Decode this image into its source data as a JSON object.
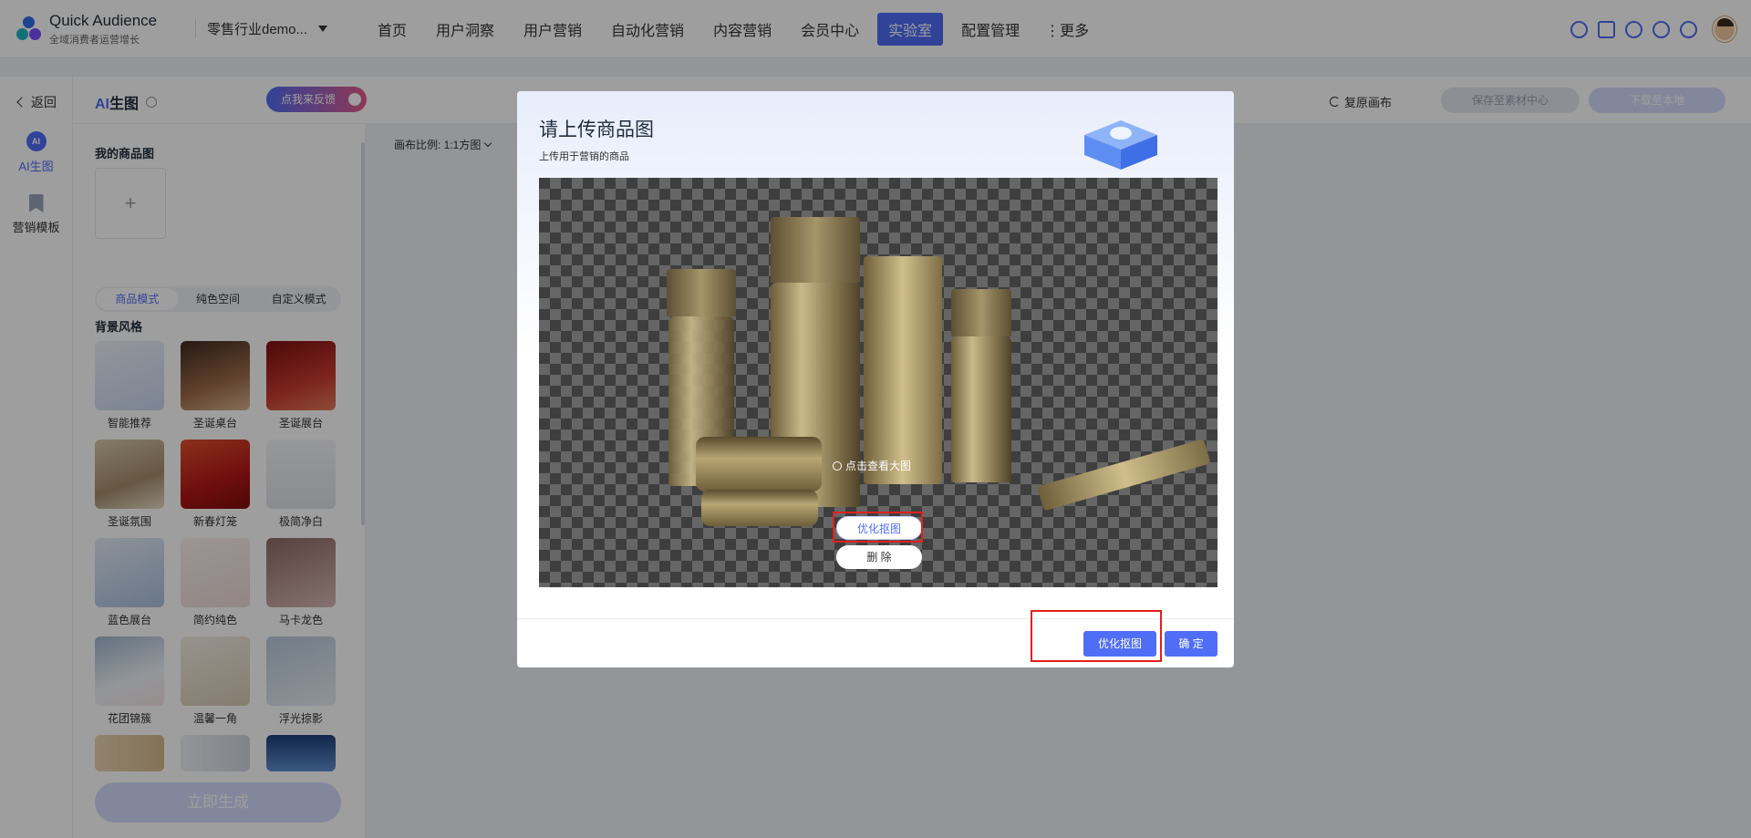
{
  "app": {
    "name": "Quick Audience",
    "slogan": "全域消费者运营增长"
  },
  "org_select": {
    "value": "零售行业demo..."
  },
  "nav": {
    "items": [
      "首页",
      "用户洞察",
      "用户营销",
      "自动化营销",
      "内容营销",
      "会员中心",
      "实验室",
      "配置管理"
    ],
    "active": "实验室",
    "more": "⋮更多"
  },
  "top_icons": [
    "search-user-icon",
    "briefcase-icon",
    "bell-icon",
    "help-icon",
    "globe-icon"
  ],
  "rail": {
    "back": "返回",
    "items": [
      {
        "label": "AI生图",
        "icon": "ai-icon"
      },
      {
        "label": "营销模板",
        "icon": "bookmark-icon"
      }
    ]
  },
  "page": {
    "title_ai": "AI",
    "title_rest": "生图",
    "feedback": "点我来反馈",
    "reset": "复原画布",
    "save": "保存至素材中心",
    "download": "下载至本地"
  },
  "panel": {
    "my_products_title": "我的商品图",
    "upload_plus": "+",
    "modes": [
      "商品模式",
      "纯色空间",
      "自定义模式"
    ],
    "active_mode": "商品模式",
    "bg_style_title": "背景风格",
    "styles": [
      {
        "label": "智能推荐",
        "color": "#dfe6f4"
      },
      {
        "label": "圣诞桌台",
        "color": "#7a4a36"
      },
      {
        "label": "圣诞展台",
        "color": "#b82b2b"
      },
      {
        "label": "圣诞氛围",
        "color": "#c8b69a"
      },
      {
        "label": "新春灯笼",
        "color": "#c1281e"
      },
      {
        "label": "极简净白",
        "color": "#e9eaec"
      },
      {
        "label": "蓝色展台",
        "color": "#c5d6ec"
      },
      {
        "label": "简约纯色",
        "color": "#f3e6e4"
      },
      {
        "label": "马卡龙色",
        "color": "#caa7a3"
      },
      {
        "label": "花团锦簇",
        "color": "#d7e3ee"
      },
      {
        "label": "温馨一角",
        "color": "#ece4d8"
      },
      {
        "label": "浮光掠影",
        "color": "#c9d6e2"
      },
      {
        "label": "",
        "color": "#e6d2b4"
      },
      {
        "label": "",
        "color": "#dde2e9"
      },
      {
        "label": "",
        "color": "#2f5d9c"
      }
    ],
    "generate": "立即生成"
  },
  "canvas": {
    "ratio_label": "画布比例: 1:1方图"
  },
  "modal": {
    "title": "请上传商品图",
    "subtitle": "上传用于营销的商品",
    "view_large": "点击查看大图",
    "optimize_pill": "优化抠图",
    "delete_pill": "删 除",
    "footer_optimize": "优化抠图",
    "footer_ok": "确 定"
  },
  "colors": {
    "accent": "#4f6df5",
    "highlight": "#e02020"
  }
}
